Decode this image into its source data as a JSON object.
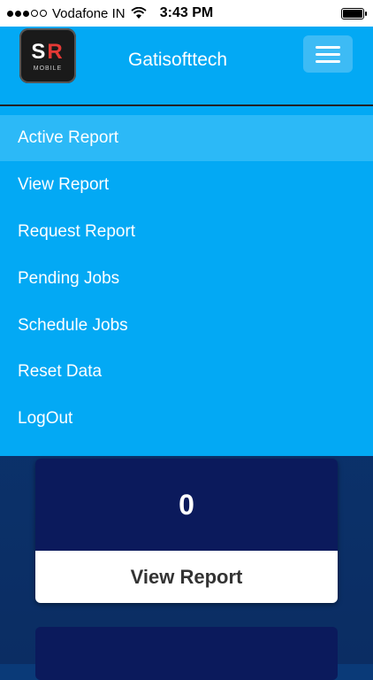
{
  "status_bar": {
    "carrier": "Vodafone IN",
    "time": "3:43 PM"
  },
  "header": {
    "logo_letters_s": "S",
    "logo_letters_r": "R",
    "logo_subtitle": "MOBILE",
    "title": "Gatisofttech"
  },
  "menu": {
    "items": [
      {
        "label": "Active Report"
      },
      {
        "label": "View Report"
      },
      {
        "label": "Request Report"
      },
      {
        "label": "Pending Jobs"
      },
      {
        "label": "Schedule Jobs"
      },
      {
        "label": "Reset Data"
      },
      {
        "label": "LogOut"
      }
    ]
  },
  "card": {
    "count": "0",
    "action_label": "View Report"
  },
  "colors": {
    "header_bg": "#03a9f4",
    "active_item_bg": "#2cb9f7",
    "card_dark": "#0b1a5c"
  }
}
